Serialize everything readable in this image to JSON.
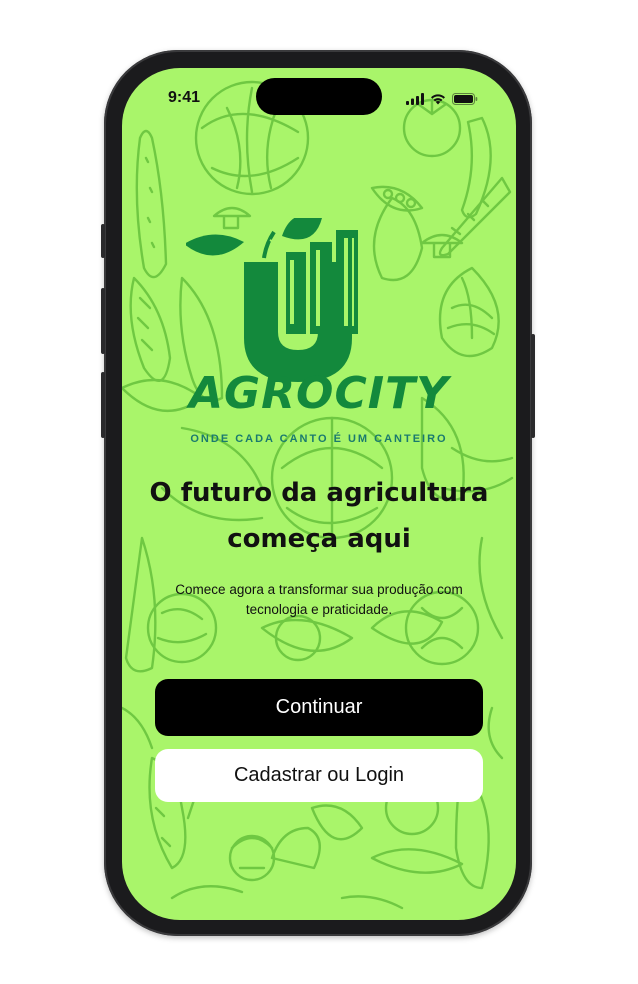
{
  "status_bar": {
    "time": "9:41"
  },
  "brand": {
    "name": "AGROCITY",
    "tagline": "ONDE CADA CANTO É UM CANTEIRO"
  },
  "headline": {
    "line1": "O futuro da agricultura",
    "line2": "começa aqui"
  },
  "subtitle": {
    "line1": "Comece agora a transformar sua produção com",
    "line2": "tecnologia e praticidade."
  },
  "buttons": {
    "continue_label": "Continuar",
    "login_label": "Cadastrar ou Login"
  },
  "colors": {
    "background": "#a9f56a",
    "pattern_stroke": "#6fc842",
    "brand_green": "#13893c",
    "tagline": "#1a7a6e",
    "primary_button": "#000000",
    "secondary_button": "#ffffff"
  },
  "icons": [
    "cellular-signal-icon",
    "wifi-icon",
    "battery-icon",
    "agrocity-logo",
    "vegetable-pattern"
  ]
}
